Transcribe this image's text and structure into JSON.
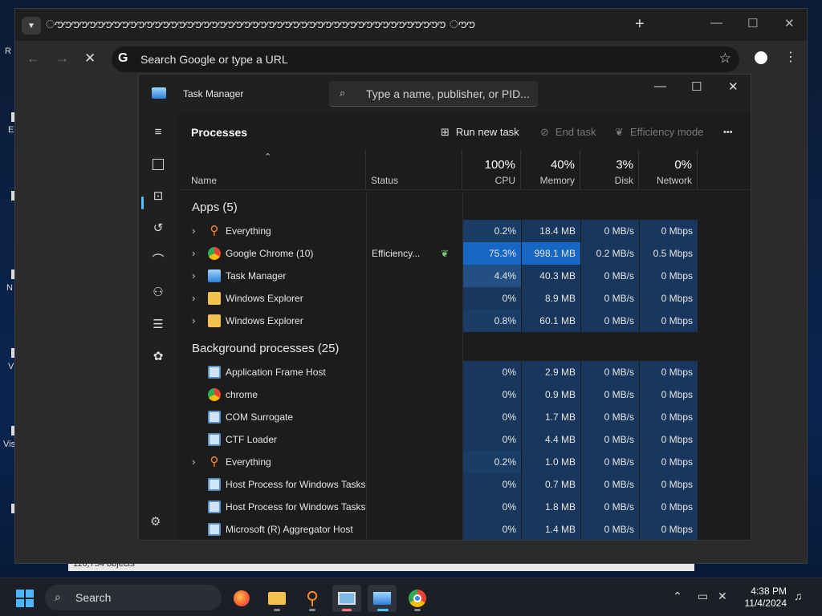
{
  "browser": {
    "tab_title": "ൗൗൗൗൗൗൗൗൗൗൗൗൗൗൗൗൗൗൗൗൗൗൗൗൗൗൗൗൗൗൗൗൗൗൗൗൗൗൗൗൗൗൗൗൗൗൗൗ ൗൗ",
    "new_tab": "+",
    "omnibox_placeholder": "Search Google or type a URL",
    "google_glyph": "G"
  },
  "desktop": {
    "icon_letters": [
      "R",
      "E",
      "N",
      "V",
      "Vis"
    ],
    "explorer_status": "116,754 objects"
  },
  "task_manager": {
    "title": "Task Manager",
    "search_placeholder": "Type a name, publisher, or PID...",
    "page_title": "Processes",
    "commands": {
      "run_new_task": "Run new task",
      "end_task": "End task",
      "efficiency_mode": "Efficiency mode",
      "more": "•••"
    },
    "columns": {
      "name": "Name",
      "status": "Status",
      "cpu_pct": "100%",
      "cpu": "CPU",
      "memory_pct": "40%",
      "memory": "Memory",
      "disk_pct": "3%",
      "disk": "Disk",
      "network_pct": "0%",
      "network": "Network"
    },
    "apps_group": "Apps (5)",
    "background_group": "Background processes (25)",
    "apps": [
      {
        "name": "Everything",
        "status": "",
        "cpu": "0.2%",
        "memory": "18.4 MB",
        "disk": "0 MB/s",
        "network": "0 Mbps",
        "icon": "search-orange"
      },
      {
        "name": "Google Chrome (10)",
        "status": "Efficiency...",
        "cpu": "75.3%",
        "memory": "998.1 MB",
        "disk": "0.2 MB/s",
        "network": "0.5 Mbps",
        "icon": "chrome"
      },
      {
        "name": "Task Manager",
        "status": "",
        "cpu": "4.4%",
        "memory": "40.3 MB",
        "disk": "0 MB/s",
        "network": "0 Mbps",
        "icon": "task-manager"
      },
      {
        "name": "Windows Explorer",
        "status": "",
        "cpu": "0%",
        "memory": "8.9 MB",
        "disk": "0 MB/s",
        "network": "0 Mbps",
        "icon": "folder"
      },
      {
        "name": "Windows Explorer",
        "status": "",
        "cpu": "0.8%",
        "memory": "60.1 MB",
        "disk": "0 MB/s",
        "network": "0 Mbps",
        "icon": "folder"
      }
    ],
    "background": [
      {
        "name": "Application Frame Host",
        "cpu": "0%",
        "memory": "2.9 MB",
        "disk": "0 MB/s",
        "network": "0 Mbps",
        "icon": "app-window",
        "expandable": false
      },
      {
        "name": "chrome",
        "cpu": "0%",
        "memory": "0.9 MB",
        "disk": "0 MB/s",
        "network": "0 Mbps",
        "icon": "chrome",
        "expandable": false
      },
      {
        "name": "COM Surrogate",
        "cpu": "0%",
        "memory": "1.7 MB",
        "disk": "0 MB/s",
        "network": "0 Mbps",
        "icon": "app-window",
        "expandable": false
      },
      {
        "name": "CTF Loader",
        "cpu": "0%",
        "memory": "4.4 MB",
        "disk": "0 MB/s",
        "network": "0 Mbps",
        "icon": "app-window",
        "expandable": false
      },
      {
        "name": "Everything",
        "cpu": "0.2%",
        "memory": "1.0 MB",
        "disk": "0 MB/s",
        "network": "0 Mbps",
        "icon": "search-orange",
        "expandable": true
      },
      {
        "name": "Host Process for Windows Tasks",
        "cpu": "0%",
        "memory": "0.7 MB",
        "disk": "0 MB/s",
        "network": "0 Mbps",
        "icon": "app-window",
        "expandable": false
      },
      {
        "name": "Host Process for Windows Tasks",
        "cpu": "0%",
        "memory": "1.8 MB",
        "disk": "0 MB/s",
        "network": "0 Mbps",
        "icon": "app-window",
        "expandable": false
      },
      {
        "name": "Microsoft (R) Aggregator Host",
        "cpu": "0%",
        "memory": "1.4 MB",
        "disk": "0 MB/s",
        "network": "0 Mbps",
        "icon": "app-window",
        "expandable": false
      }
    ]
  },
  "taskbar": {
    "search_label": "Search",
    "time": "4:38 PM",
    "date": "11/4/2024"
  },
  "colors": {
    "accent": "#4cc2ff",
    "cpu_hot": "#1666c4",
    "heat_low": "#19375c"
  }
}
